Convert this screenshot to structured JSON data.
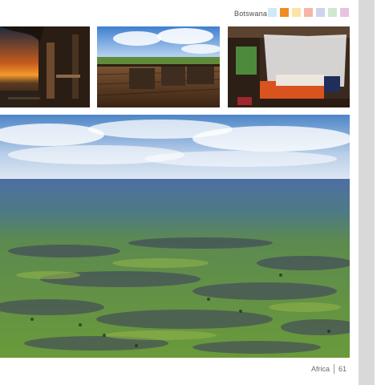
{
  "header": {
    "section_label": "Botswana",
    "swatch_colors": [
      "#cfe9f7",
      "#f08a24",
      "#fde3a6",
      "#f6b6a7",
      "#cdd3ec",
      "#cfe8cf",
      "#e7c2df"
    ]
  },
  "photos": [
    {
      "subject": "sunset over delta from lodge deck"
    },
    {
      "subject": "wooden deck with lounge chairs and blue sky"
    },
    {
      "subject": "lodge bedroom with mosquito net bed"
    },
    {
      "subject": "aerial view of Okavango Delta wetlands"
    }
  ],
  "footer": {
    "region": "Africa",
    "page_number": "61"
  }
}
